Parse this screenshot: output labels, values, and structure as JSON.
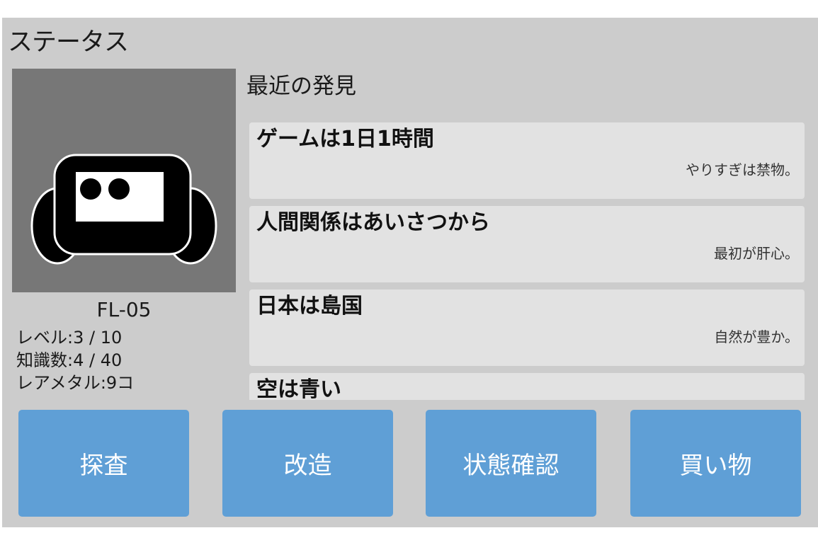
{
  "screen": {
    "title": "ステータス"
  },
  "robot": {
    "name": "FL-05",
    "portrait_icon": "robot-icon",
    "stats": [
      {
        "label": "レベル",
        "value": "3 / 10"
      },
      {
        "label": "知識数",
        "value": "4 / 40"
      },
      {
        "label": "レアメタル",
        "value": "9コ"
      }
    ]
  },
  "discoveries": {
    "heading": "最近の発見",
    "items": [
      {
        "title": "ゲームは1日1時間",
        "note": "やりすぎは禁物。"
      },
      {
        "title": "人間関係はあいさつから",
        "note": "最初が肝心。"
      },
      {
        "title": "日本は島国",
        "note": "自然が豊か。"
      },
      {
        "title": "空は青い",
        "note": ""
      }
    ]
  },
  "actions": [
    {
      "label": "探査"
    },
    {
      "label": "改造"
    },
    {
      "label": "状態確認"
    },
    {
      "label": "買い物"
    }
  ],
  "colors": {
    "panel_bg": "#cccccc",
    "portrait_bg": "#777777",
    "card_bg": "#e2e2e2",
    "button_bg": "#5f9fd6",
    "button_text": "#ffffff"
  }
}
